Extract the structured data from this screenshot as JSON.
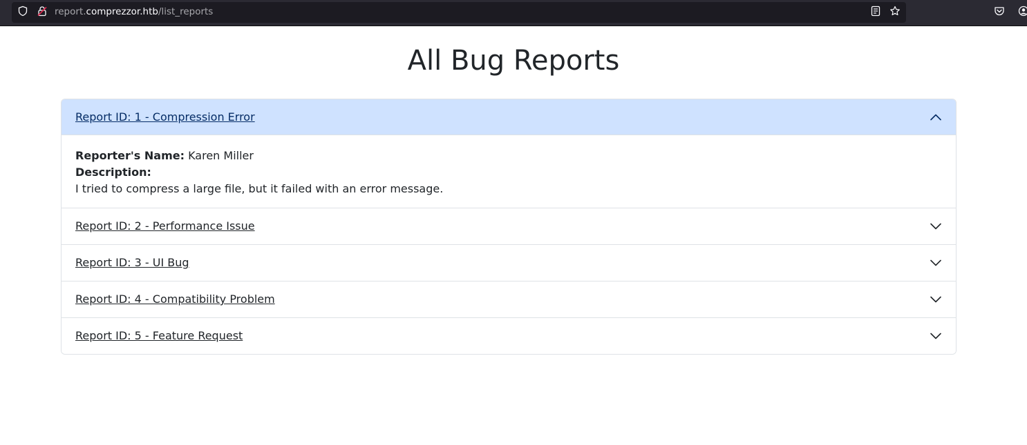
{
  "browser": {
    "url_prefix": "report.",
    "url_host": "comprezzor.htb",
    "url_path": "/list_reports"
  },
  "page": {
    "title": "All Bug Reports"
  },
  "reports": [
    {
      "title": "Report ID: 1 - Compression Error",
      "expanded": true,
      "reporter_label": "Reporter's Name:",
      "reporter_name": "Karen Miller",
      "description_label": "Description:",
      "description": "I tried to compress a large file, but it failed with an error message."
    },
    {
      "title": "Report ID: 2 - Performance Issue",
      "expanded": false
    },
    {
      "title": "Report ID: 3 - UI Bug",
      "expanded": false
    },
    {
      "title": "Report ID: 4 - Compatibility Problem",
      "expanded": false
    },
    {
      "title": "Report ID: 5 - Feature Request",
      "expanded": false
    }
  ],
  "icons": {
    "shield": "shield-icon",
    "lock": "insecure-lock-icon",
    "reader": "reader-view-icon",
    "bookmark": "bookmark-star-icon",
    "pocket": "pocket-icon",
    "account": "account-icon",
    "chevron_up": "chevron-up-icon",
    "chevron_down": "chevron-down-icon"
  },
  "colors": {
    "toolbar": "#2b2a33",
    "urlbar": "#1c1b22",
    "active_header": "#cfe2ff",
    "active_text": "#052c65",
    "border": "#dee2e6"
  }
}
